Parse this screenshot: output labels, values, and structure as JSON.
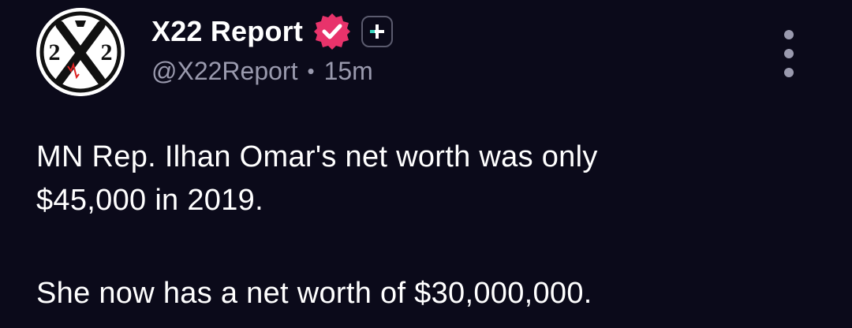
{
  "author": {
    "display_name": "X22 Report",
    "handle": "@X22Report",
    "time": "15m",
    "separator": "•",
    "avatar_text_left": "2",
    "avatar_text_right": "2",
    "avatar_icon": "x22-logo-icon"
  },
  "icons": {
    "verified": "verified-badge-icon",
    "follow": "plus-icon",
    "menu": "more-vertical-icon"
  },
  "colors": {
    "background": "#0b0a1a",
    "text_primary": "#ffffff",
    "text_secondary": "#9a9aae",
    "verified_badge": "#e8336b",
    "follow_plus_accent": "#39d8c0"
  },
  "post": {
    "paragraph1_line1": "MN Rep. Ilhan Omar's net worth was only",
    "paragraph1_line2": "$45,000 in 2019.",
    "paragraph2": "She now has a net worth of $30,000,000."
  }
}
